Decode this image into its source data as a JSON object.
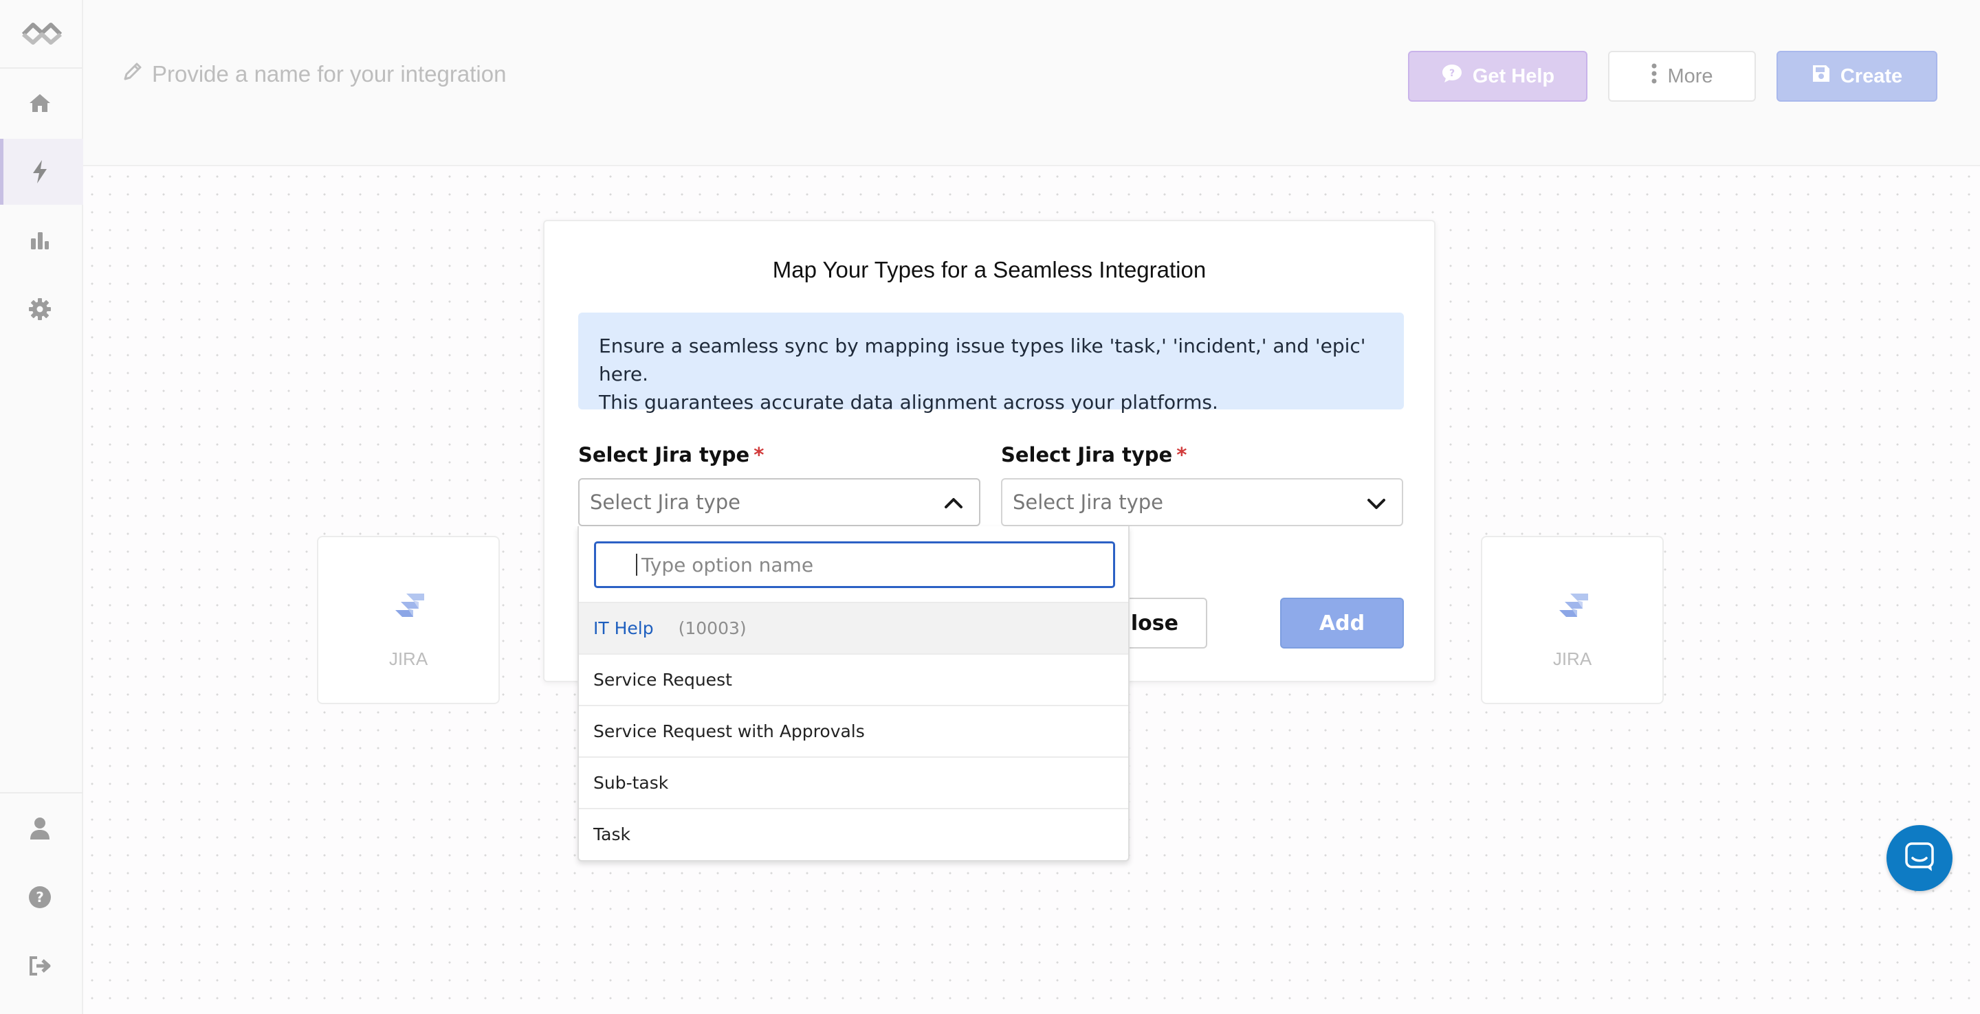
{
  "header": {
    "integration_name_placeholder": "Provide a name for your integration",
    "get_help_label": "Get Help",
    "more_label": "More",
    "create_label": "Create"
  },
  "sidebar": {
    "top_icons": [
      "home-icon",
      "bolt-icon",
      "bar-chart-icon",
      "gear-icon"
    ],
    "bottom_icons": [
      "user-icon",
      "help-icon",
      "logout-icon"
    ],
    "active_item": "bolt-icon"
  },
  "nodes": {
    "left_label": "JIRA",
    "right_label": "JIRA"
  },
  "modal": {
    "title": "Map Your Types for a Seamless Integration",
    "info_line1": "Ensure a seamless sync by mapping issue types like 'task,' 'incident,' and 'epic' here.",
    "info_line2": "This guarantees accurate data alignment across your platforms.",
    "left_field_label": "Select Jira type",
    "right_field_label": "Select Jira type",
    "required_marker": "*",
    "left_select_placeholder": "Select Jira type",
    "right_select_placeholder": "Select Jira type",
    "close_label": "Close",
    "add_label": "Add"
  },
  "dropdown": {
    "search_placeholder": "Type option name",
    "options": [
      {
        "label": "IT Help",
        "code": "(10003)"
      },
      {
        "label": "Service Request"
      },
      {
        "label": "Service Request with Approvals"
      },
      {
        "label": "Sub-task"
      },
      {
        "label": "Task"
      }
    ]
  },
  "colors": {
    "accent": "#2c61c5",
    "add_button": "#8eaaea",
    "info_bg": "#deebfd",
    "required": "#d13b3b",
    "chat": "#0e7bc4"
  }
}
